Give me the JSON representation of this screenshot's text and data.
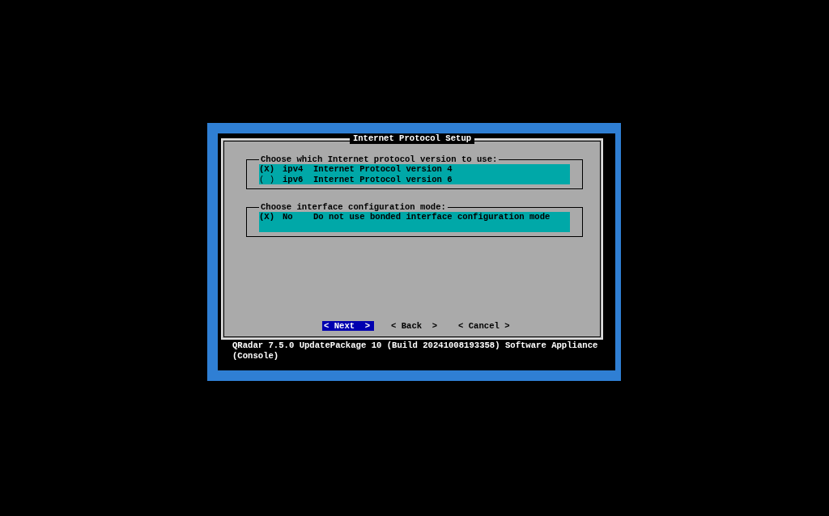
{
  "dialog": {
    "title": "Internet Protocol Setup",
    "groups": [
      {
        "legend": "Choose which Internet protocol version to use:",
        "options": [
          {
            "marker": "(X)",
            "tag": "ipv4",
            "description": "Internet Protocol version 4",
            "selected": true
          },
          {
            "marker": "( )",
            "tag": "ipv6",
            "description": "Internet Protocol version 6",
            "selected": false
          }
        ]
      },
      {
        "legend": "Choose interface configuration mode:",
        "options": [
          {
            "marker": "(X)",
            "tag": "No",
            "description": "Do not use bonded interface configuration mode",
            "selected": true
          }
        ]
      }
    ],
    "buttons": [
      {
        "label": "< Next  >",
        "selected": true
      },
      {
        "label": "< Back  >",
        "selected": false
      },
      {
        "label": "< Cancel >",
        "selected": false
      }
    ],
    "footer": "QRadar 7.5.0 UpdatePackage 10 (Build 20241008193358) Software Appliance (Console)"
  }
}
